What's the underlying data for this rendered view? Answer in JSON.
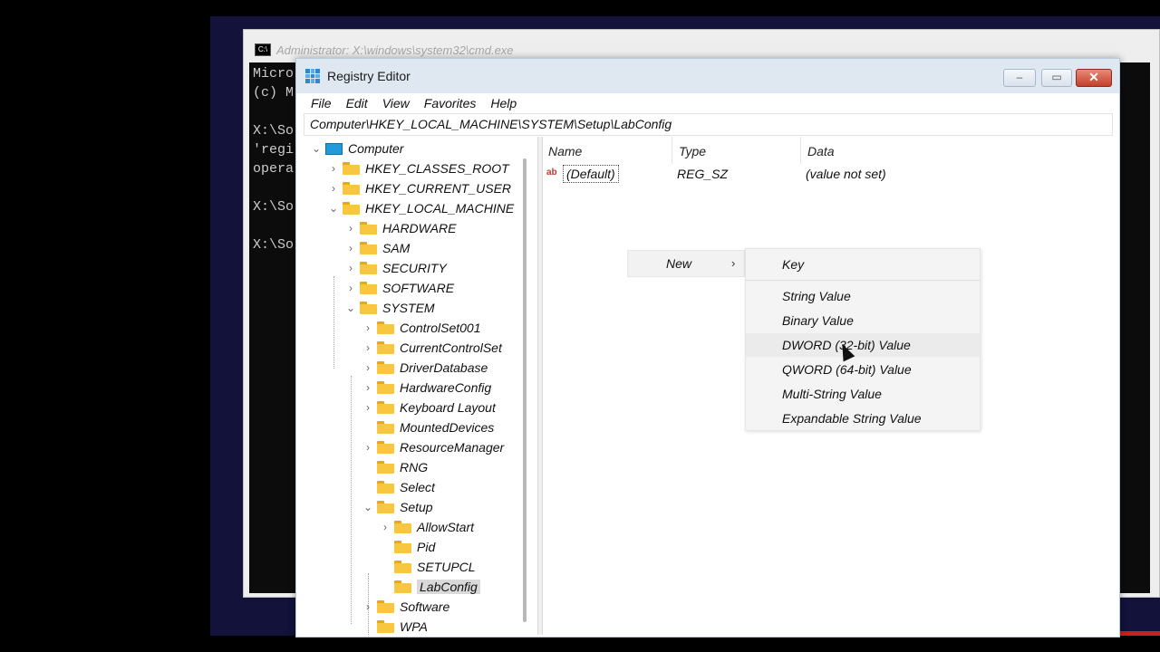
{
  "cmd": {
    "title": "Administrator: X:\\windows\\system32\\cmd.exe",
    "icon": "cmd-icon",
    "lines": [
      "Micro",
      "(c) M",
      "",
      "X:\\So",
      "'regi",
      "opera",
      "",
      "X:\\So",
      "",
      "X:\\So"
    ]
  },
  "regedit": {
    "title": "Registry Editor",
    "menu": [
      "File",
      "Edit",
      "View",
      "Favorites",
      "Help"
    ],
    "address": "Computer\\HKEY_LOCAL_MACHINE\\SYSTEM\\Setup\\LabConfig",
    "window_buttons": {
      "minimize": "–",
      "maximize": "▭",
      "close": "✕"
    },
    "tree": {
      "computer": "Computer",
      "hkcr": "HKEY_CLASSES_ROOT",
      "hkcu": "HKEY_CURRENT_USER",
      "hklm": "HKEY_LOCAL_MACHINE",
      "hardware": "HARDWARE",
      "sam": "SAM",
      "security": "SECURITY",
      "software_top": "SOFTWARE",
      "system": "SYSTEM",
      "controlset001": "ControlSet001",
      "currentcontrolset": "CurrentControlSet",
      "driverdatabase": "DriverDatabase",
      "hardwareconfig": "HardwareConfig",
      "keyboardlayout": "Keyboard Layout",
      "mounteddevices": "MountedDevices",
      "resourcemanager": "ResourceManager",
      "rng": "RNG",
      "select": "Select",
      "setup": "Setup",
      "allowstart": "AllowStart",
      "pid": "Pid",
      "setupcl": "SETUPCL",
      "labconfig": "LabConfig",
      "software": "Software",
      "wpa": "WPA"
    },
    "columns": {
      "name": "Name",
      "type": "Type",
      "data": "Data"
    },
    "values": [
      {
        "icon": "ab",
        "name": "(Default)",
        "type": "REG_SZ",
        "data": "(value not set)"
      }
    ],
    "context_menu": {
      "new_label": "New",
      "new_arrow": "›",
      "submenu": {
        "key": "Key",
        "string": "String Value",
        "binary": "Binary Value",
        "dword": "DWORD (32-bit) Value",
        "qword": "QWORD (64-bit) Value",
        "multi": "Multi-String Value",
        "expand": "Expandable String Value"
      }
    }
  },
  "colors": {
    "desktop": "#12123a",
    "folder": "#f9c73f",
    "close_button": "#c4402c",
    "selection": "#d9d9d9"
  }
}
